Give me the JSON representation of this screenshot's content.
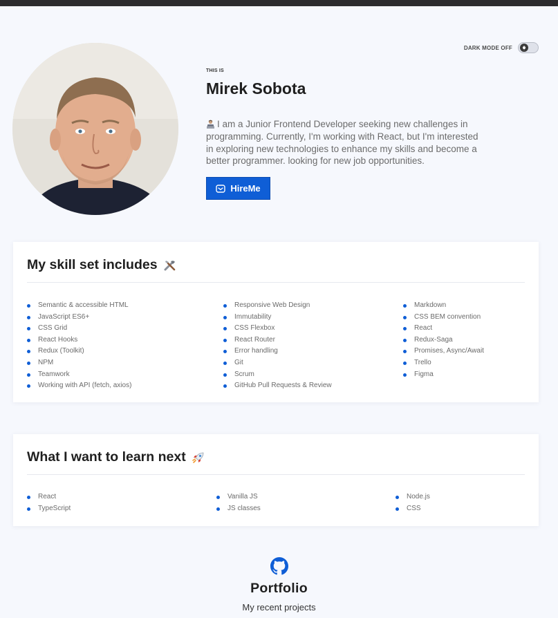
{
  "theme": {
    "toggle_label": "DARK MODE OFF",
    "accent": "#0f5ed6"
  },
  "hero": {
    "eyebrow": "THIS IS",
    "name": "Mirek Sobota",
    "bio": "I am a Junior Frontend Developer seeking new challenges in programming. Currently, I'm working with React, but I'm interested in exploring new technologies to enhance my skills and become a better programmer. looking for new job opportunities.",
    "bio_icon": "technologist-emoji",
    "cta_label": "HireMe",
    "cta_icon": "mail-icon"
  },
  "skills": {
    "title": "My skill set includes",
    "title_icon": "tools-emoji",
    "col1": [
      "Semantic & accessible HTML",
      "JavaScript ES6+",
      "CSS Grid",
      "React Hooks",
      "Redux (Toolkit)",
      "NPM",
      "Teamwork",
      "Working with API (fetch, axios)"
    ],
    "col2": [
      "Responsive Web Design",
      "Immutability",
      "CSS Flexbox",
      "React Router",
      "Error handling",
      "Git",
      "Scrum",
      "GitHub Pull Requests & Review"
    ],
    "col3": [
      "Markdown",
      "CSS BEM convention",
      "React",
      "Redux-Saga",
      "Promises, Async/Await",
      "Trello",
      "Figma"
    ]
  },
  "learn": {
    "title": "What I want to learn next",
    "title_icon": "rocket-emoji",
    "col1": [
      "React",
      "TypeScript"
    ],
    "col2": [
      "Vanilla JS",
      "JS classes"
    ],
    "col3": [
      "Node.js",
      "CSS"
    ]
  },
  "portfolio": {
    "icon": "github-icon",
    "title": "Portfolio",
    "subtitle": "My recent projects"
  }
}
